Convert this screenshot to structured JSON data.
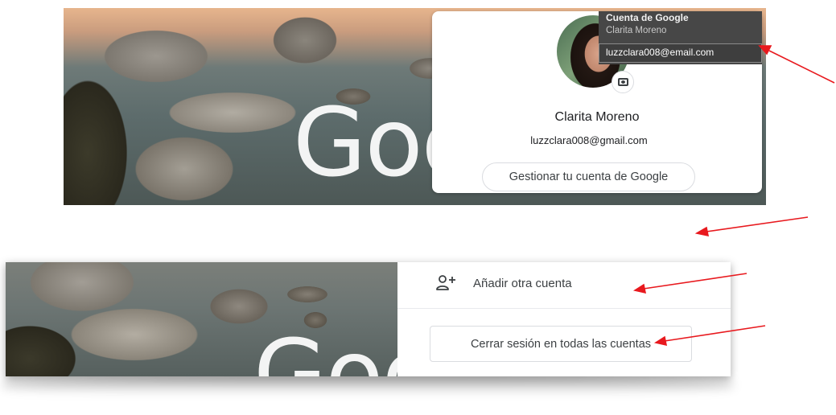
{
  "top_panel": {
    "background_wordmark": "Goo",
    "tooltip": {
      "title": "Cuenta de Google",
      "name": "Clarita Moreno",
      "email": "luzzclara008@email.com"
    },
    "card": {
      "name": "Clarita Moreno",
      "email": "luzzclara008@gmail.com",
      "manage_button": "Gestionar tu cuenta de Google"
    }
  },
  "bottom_panel": {
    "background_wordmark": "Goo",
    "add_account_label": "Añadir otra cuenta",
    "signout_button": "Cerrar sesión en todas las cuentas"
  },
  "icons": {
    "camera": "camera-icon",
    "add_person": "person-add-icon"
  },
  "colors": {
    "annotation_arrow": "#e8191e",
    "tooltip_bg": "#474747",
    "text_primary": "#202124",
    "button_border": "#dadce0"
  }
}
